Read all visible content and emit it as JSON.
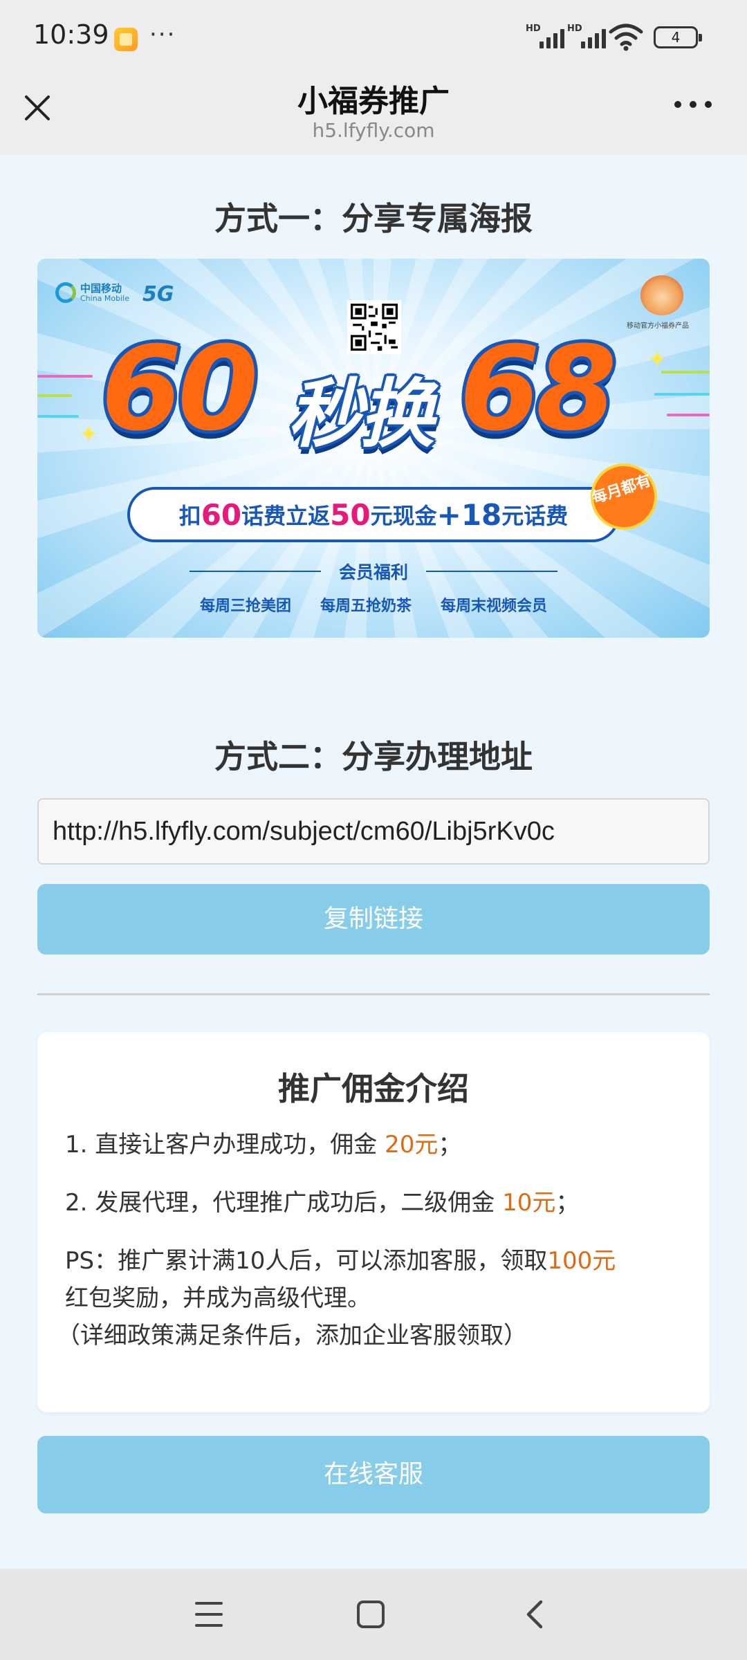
{
  "status_bar": {
    "time": "10:39",
    "overflow": "···",
    "signal_1_label": "HD",
    "signal_2_label": "HD",
    "battery": "4",
    "icons": [
      "notification-app-icon",
      "signal-icon",
      "signal-icon",
      "wifi-icon",
      "battery-icon"
    ]
  },
  "title_bar": {
    "title": "小福券推广",
    "url": "h5.lfyfly.com",
    "close_icon": "close-icon",
    "menu_icon": "more-icon"
  },
  "section1": {
    "title": "方式一：分享专属海报"
  },
  "poster": {
    "brand": "中国移动",
    "brand_sub": "China Mobile",
    "badge_5g": "5G",
    "mascot_caption": "移动官方小福券产品",
    "num_left": "60",
    "headline": "秒换",
    "num_right": "68",
    "promo_part1": "扣",
    "promo_num1": "60",
    "promo_part2": "话费立返",
    "promo_num2": "50",
    "promo_part3": "元现金 ",
    "promo_num3": "+18",
    "promo_part4": "元话费",
    "monthly_badge": "每月都有",
    "benefit_title": "会员福利",
    "benefits": [
      "每周三抢美团",
      "每周五抢奶茶",
      "每周末视频会员"
    ]
  },
  "section2": {
    "title": "方式二：分享办理地址",
    "url_value": "http://h5.lfyfly.com/subject/cm60/Libj5rKv0c",
    "copy_button": "复制链接"
  },
  "commission": {
    "title": "推广佣金介绍",
    "line1_text": "1. 直接让客户办理成功，佣金 ",
    "line1_amount": "20元",
    "line1_end": "；",
    "line2_text": "2. 发展代理，代理推广成功后，二级佣金 ",
    "line2_amount": "10元",
    "line2_end": "；",
    "ps_text": "PS：推广累计满10人后，可以添加客服，领取",
    "ps_amount": "100元",
    "ps_line2": "红包奖励，并成为高级代理。",
    "ps_line3": "（详细政策满足条件后，添加企业客服领取）"
  },
  "support_button": "在线客服",
  "nav": {
    "icons": [
      "menu-icon",
      "home-icon",
      "back-icon"
    ]
  },
  "colors": {
    "accent_button": "#87cdea",
    "highlight": "#e06a13",
    "background": "#eef6fd"
  }
}
